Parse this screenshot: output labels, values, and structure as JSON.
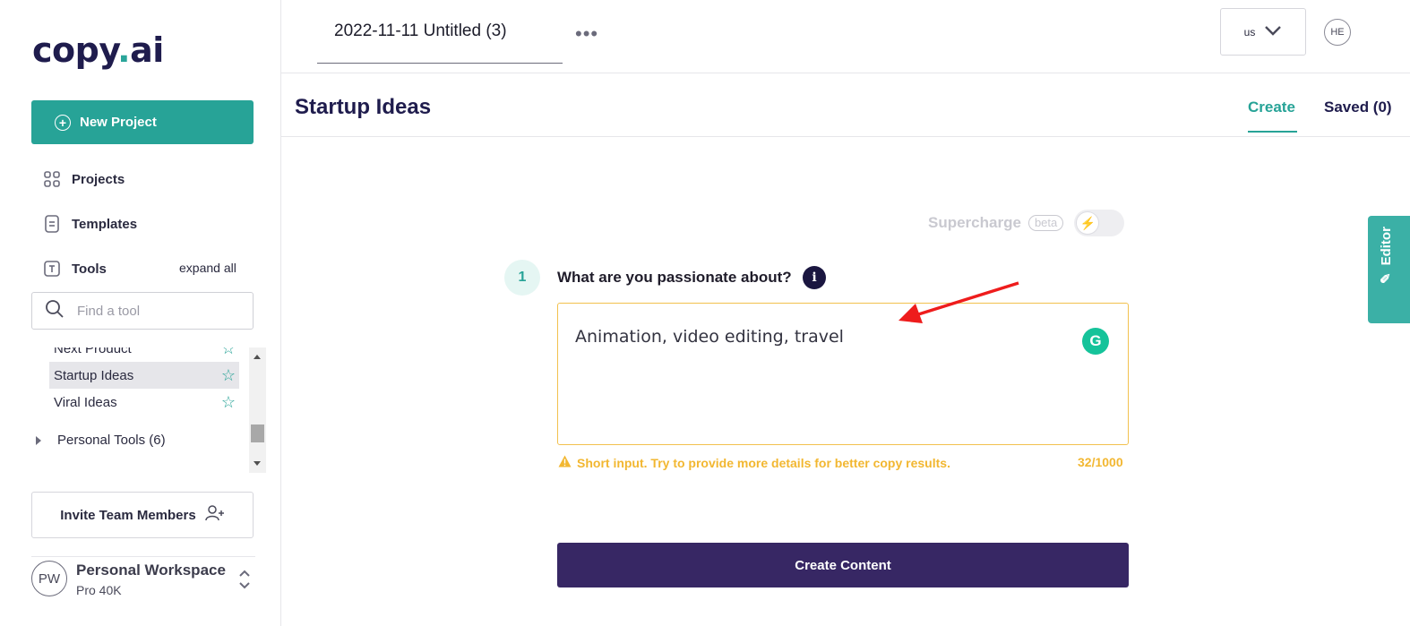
{
  "app": {
    "logo_main": "copy",
    "logo_dot": ".",
    "logo_tail": "ai"
  },
  "sidebar": {
    "new_project_label": "New Project",
    "nav": [
      {
        "label": "Projects",
        "icon": "grid-icon"
      },
      {
        "label": "Templates",
        "icon": "document-icon"
      },
      {
        "label": "Tools",
        "icon": "text-tool-icon"
      }
    ],
    "expand_all": "expand all",
    "search_placeholder": "Find a tool",
    "tools": [
      {
        "label": "Next Product",
        "starred": false
      },
      {
        "label": "Startup Ideas",
        "starred": false,
        "active": true
      },
      {
        "label": "Viral Ideas",
        "starred": false
      }
    ],
    "personal_tools": "Personal Tools (6)",
    "invite_label": "Invite Team Members",
    "workspace": {
      "initials": "PW",
      "name": "Personal Workspace",
      "plan": "Pro 40K"
    }
  },
  "topbar": {
    "doc_title": "2022-11-11 Untitled (3)",
    "more_label": "•••",
    "language": "us",
    "user_initials": "HE"
  },
  "page": {
    "title": "Startup Ideas",
    "tabs": [
      {
        "label": "Create",
        "active": true
      },
      {
        "label": "Saved (0)",
        "active": false
      }
    ]
  },
  "form": {
    "supercharge_label": "Supercharge",
    "beta_label": "beta",
    "step_number": "1",
    "question": "What are you passionate about?",
    "info_label": "i",
    "input_value": "Animation, video editing, travel",
    "grammarly_label": "G",
    "warning_text": "Short input. Try to provide more details for better copy results.",
    "char_count": "32/1000",
    "submit_label": "Create Content"
  },
  "editor_tab": {
    "label": "Editor"
  },
  "colors": {
    "accent": "#27a397",
    "primary_button": "#372764",
    "warning": "#f2b731",
    "annotation_arrow": "#ee1c1c"
  }
}
